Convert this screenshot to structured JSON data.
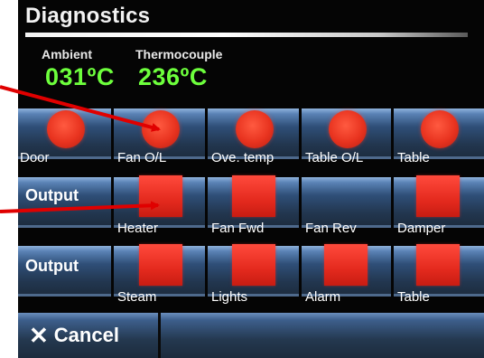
{
  "title": "Diagnostics",
  "readings": {
    "ambient": {
      "label": "Ambient",
      "value": "031ºC"
    },
    "thermocouple": {
      "label": "Thermocouple",
      "value": "236ºC"
    }
  },
  "inputs": [
    {
      "label": "Door"
    },
    {
      "label": "Fan O/L"
    },
    {
      "label": "Ove. temp"
    },
    {
      "label": "Table O/L"
    },
    {
      "label": "Table"
    }
  ],
  "output_label": "Output",
  "outputs_row1": [
    {
      "label": "Heater"
    },
    {
      "label": "Fan Fwd"
    },
    {
      "label": "Fan Rev"
    },
    {
      "label": "Damper"
    }
  ],
  "outputs_row2": [
    {
      "label": "Steam"
    },
    {
      "label": "Lights"
    },
    {
      "label": "Alarm"
    },
    {
      "label": "Table"
    }
  ],
  "cancel_label": "Cancel",
  "colors": {
    "accent_green": "#6dff3c",
    "indicator_red": "#e8331f",
    "arrow_red": "#e00000"
  }
}
